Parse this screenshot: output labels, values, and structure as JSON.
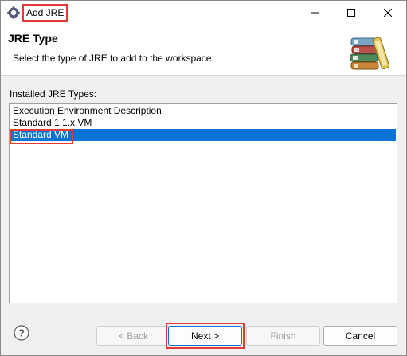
{
  "window": {
    "title": "Add JRE",
    "icon": "eclipse-gear-icon",
    "controls": [
      "minimize-icon",
      "maximize-icon",
      "close-icon"
    ]
  },
  "header": {
    "title": "JRE Type",
    "description": "Select the type of JRE to add to the workspace.",
    "icon": "books-icon"
  },
  "jre_types": {
    "label": "Installed JRE Types:",
    "items": [
      "Execution Environment Description",
      "Standard 1.1.x VM",
      "Standard VM"
    ],
    "selected": "Standard VM"
  },
  "footer": {
    "help_icon": "help-icon",
    "back_label": "< Back",
    "next_label": "Next >",
    "finish_label": "Finish",
    "cancel_label": "Cancel"
  },
  "colors": {
    "selection": "#0a74d6",
    "highlight_box": "#e53935"
  }
}
